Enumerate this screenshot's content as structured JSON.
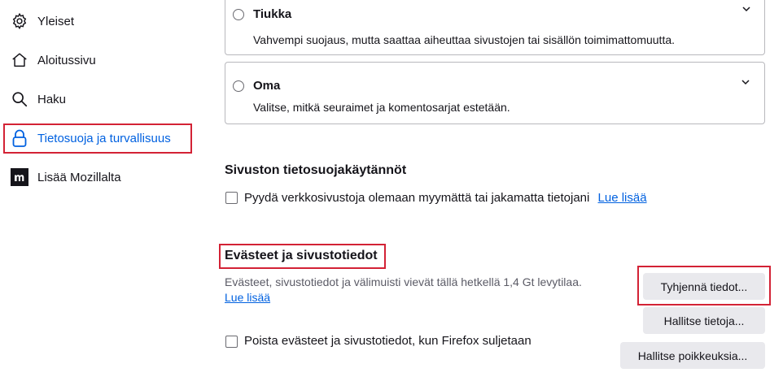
{
  "sidebar": {
    "items": [
      {
        "label": "Yleiset",
        "icon": "gear-icon"
      },
      {
        "label": "Aloitussivu",
        "icon": "home-icon"
      },
      {
        "label": "Haku",
        "icon": "search-icon"
      },
      {
        "label": "Tietosuoja ja turvallisuus",
        "icon": "lock-icon",
        "selected": true
      },
      {
        "label": "Lisää Mozillalta",
        "icon": "mozilla-icon"
      }
    ]
  },
  "tracking": {
    "strict": {
      "title": "Tiukka",
      "description": "Vahvempi suojaus, mutta saattaa aiheuttaa sivustojen tai sisällön toimimattomuutta."
    },
    "custom": {
      "title": "Oma",
      "description": "Valitse, mitkä seuraimet ja komentosarjat estetään."
    }
  },
  "site_privacy": {
    "title": "Sivuston tietosuojakäytännöt",
    "checkbox_label": "Pyydä verkkosivustoja olemaan myymättä tai jakamatta tietojani",
    "learn_more": "Lue lisää"
  },
  "cookies": {
    "title": "Evästeet ja sivustotiedot",
    "description": "Evästeet, sivustotiedot ja välimuisti vievät tällä hetkellä 1,4 Gt levytilaa.",
    "learn_more": "Lue lisää",
    "clear_button": "Tyhjennä tiedot...",
    "manage_button": "Hallitse tietoja...",
    "exceptions_button": "Hallitse poikkeuksia...",
    "delete_on_close_label": "Poista evästeet ja sivustotiedot, kun Firefox suljetaan"
  }
}
